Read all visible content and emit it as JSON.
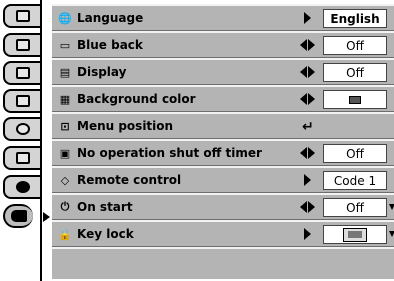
{
  "menu": {
    "items": [
      {
        "label": "Language",
        "icon": "globe-icon",
        "control": "arrow-right",
        "value": "English",
        "value_bold": true
      },
      {
        "label": "Blue back",
        "icon": "screen-outline-icon",
        "control": "arrows-left-right",
        "value": "Off",
        "value_bold": false
      },
      {
        "label": "Display",
        "icon": "display-icon",
        "control": "arrows-left-right",
        "value": "Off",
        "value_bold": false
      },
      {
        "label": "Background color",
        "icon": "background-color-icon",
        "control": "arrows-left-right",
        "value": "",
        "value_icon": "color-swatch-icon"
      },
      {
        "label": "Menu position",
        "icon": "menu-position-icon",
        "control": "enter",
        "value": ""
      },
      {
        "label": "No operation shut off timer",
        "icon": "timer-screen-icon",
        "control": "arrows-left-right",
        "value": "Off",
        "value_bold": false
      },
      {
        "label": "Remote control",
        "icon": "remote-control-icon",
        "control": "arrow-right",
        "value": "Code 1",
        "value_bold": false
      },
      {
        "label": "On start",
        "icon": "power-on-icon",
        "control": "arrows-left-right",
        "value": "Off",
        "value_bold": false
      },
      {
        "label": "Key lock",
        "icon": "lock-icon",
        "control": "arrow-right",
        "value": "",
        "value_icon": "keylock-projector-icon"
      }
    ],
    "enter_glyph": "↵",
    "icon_glyphs": {
      "globe": "🌐",
      "screen": "▭",
      "display": "▤",
      "background": "▦",
      "menu_position": "⊡",
      "timer": "▣",
      "remote": "◇",
      "power": "⏻",
      "lock": "🔒"
    }
  }
}
